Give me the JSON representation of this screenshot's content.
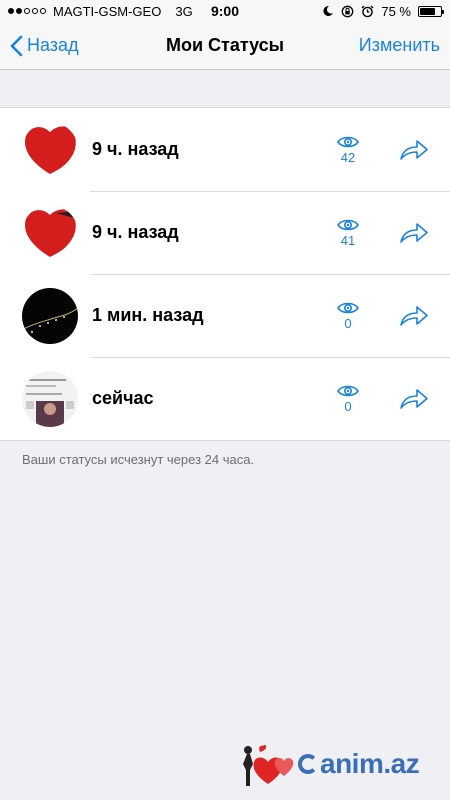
{
  "status_bar": {
    "carrier": "MAGTI-GSM-GEO",
    "network": "3G",
    "time": "9:00",
    "battery": "75 %",
    "battery_level": 0.75
  },
  "nav": {
    "back_label": "Назад",
    "title": "Мои Статусы",
    "edit_label": "Изменить"
  },
  "statuses": [
    {
      "time": "9 ч. назад",
      "views": "42"
    },
    {
      "time": "9 ч. назад",
      "views": "41"
    },
    {
      "time": "1 мин. назад",
      "views": "0"
    },
    {
      "time": "сейчас",
      "views": "0"
    }
  ],
  "footer_note": "Ваши статусы исчезнут через 24 часа.",
  "watermark": "anim.az",
  "colors": {
    "accent": "#1a82e0",
    "background": "#efeff4"
  }
}
